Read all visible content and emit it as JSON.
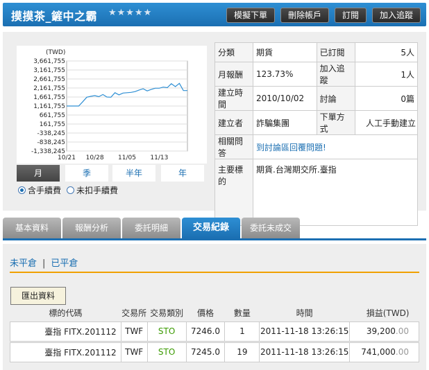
{
  "header": {
    "title": "摸摸茶_鏟中之霸",
    "stars": "★★★★★",
    "buttons": [
      "模擬下單",
      "刪除帳戶",
      "訂閱",
      "加入追蹤"
    ]
  },
  "chart_data": {
    "type": "line",
    "ylabel": "(TWD)",
    "yticks": [
      3661755,
      3161755,
      2661755,
      2161755,
      1661755,
      1161755,
      661755,
      161755,
      -338245,
      -838245,
      -1338245
    ],
    "ytick_labels": [
      "3,661,755",
      "3,161,755",
      "2,661,755",
      "2,161,755",
      "1,661,755",
      "1,161,755",
      "661,755",
      "161,755",
      "-338,245",
      "-838,245",
      "-1,338,245"
    ],
    "xtick_labels": [
      "10/21",
      "10/28",
      "11/05",
      "11/13"
    ],
    "xticks": [
      0,
      7,
      15,
      23
    ],
    "xlim": [
      0,
      30
    ],
    "ylim": [
      -1338245,
      3661755
    ],
    "grid": true,
    "series": [
      {
        "x": [
          0,
          2,
          3,
          4,
          5,
          6,
          7,
          8,
          9,
          10,
          11,
          12,
          13,
          14,
          15,
          16,
          17,
          18,
          19,
          20,
          21,
          22,
          23,
          24,
          25,
          26,
          27,
          28,
          29,
          30
        ],
        "values": [
          1161755,
          1161755,
          1161755,
          1400000,
          1650000,
          1700000,
          1740000,
          1680000,
          1800000,
          1660000,
          1650000,
          1900000,
          1780000,
          1880000,
          1900000,
          1920000,
          1960000,
          2050000,
          2120000,
          2000000,
          2080000,
          2150000,
          2150000,
          2210000,
          2180000,
          2400000,
          2240000,
          2420000,
          2020000,
          2020000
        ],
        "color": "#2e8fd4"
      }
    ]
  },
  "periods": [
    {
      "label": "月",
      "active": true
    },
    {
      "label": "季",
      "active": false
    },
    {
      "label": "半年",
      "active": false
    },
    {
      "label": "年",
      "active": false
    }
  ],
  "fee_options": [
    {
      "label": "含手續費",
      "checked": true
    },
    {
      "label": "未扣手續費",
      "checked": false
    }
  ],
  "info": {
    "category_label": "分類",
    "category_value": "期貨",
    "subscribed_label": "已訂閱",
    "subscribed_value": "5人",
    "monthly_return_label": "月報酬",
    "monthly_return_value": "123.73%",
    "tracking_label": "加入追蹤",
    "tracking_value": "1人",
    "created_time_label": "建立時間",
    "created_time_value": "2010/10/02",
    "discussion_label": "討論",
    "discussion_value": "0篇",
    "creator_label": "建立者",
    "creator_value": "詐騙集團",
    "order_method_label": "下單方式",
    "order_method_value": "人工手動建立",
    "qa_label": "相關問答",
    "qa_link": "到討論區回覆問題!",
    "main_target_label": "主要標的",
    "main_target_value": "期貨.台灣期交所.臺指"
  },
  "tabs": [
    {
      "label": "基本資料",
      "active": false
    },
    {
      "label": "報酬分析",
      "active": false
    },
    {
      "label": "委託明細",
      "active": false
    },
    {
      "label": "交易紀錄",
      "active": true
    },
    {
      "label": "委託未成交",
      "active": false
    }
  ],
  "subtabs": {
    "open": "未平倉",
    "separator": "|",
    "closed": "已平倉"
  },
  "export_label": "匯出資料",
  "trade_table": {
    "headers": [
      "標的代碼",
      "交易所",
      "交易類別",
      "價格",
      "數量",
      "時間",
      "損益(TWD)"
    ],
    "rows": [
      {
        "symbol": "臺指 FITX.201112",
        "exchange": "TWF",
        "type": "STO",
        "price": "7246.0",
        "qty": "1",
        "time": "2011-11-18 13:26:15",
        "pl": "39,200",
        "pl_cents": ".00"
      },
      {
        "symbol": "臺指 FITX.201112",
        "exchange": "TWF",
        "type": "STO",
        "price": "7245.0",
        "qty": "19",
        "time": "2011-11-18 13:26:15",
        "pl": "741,000",
        "pl_cents": ".00"
      }
    ]
  }
}
